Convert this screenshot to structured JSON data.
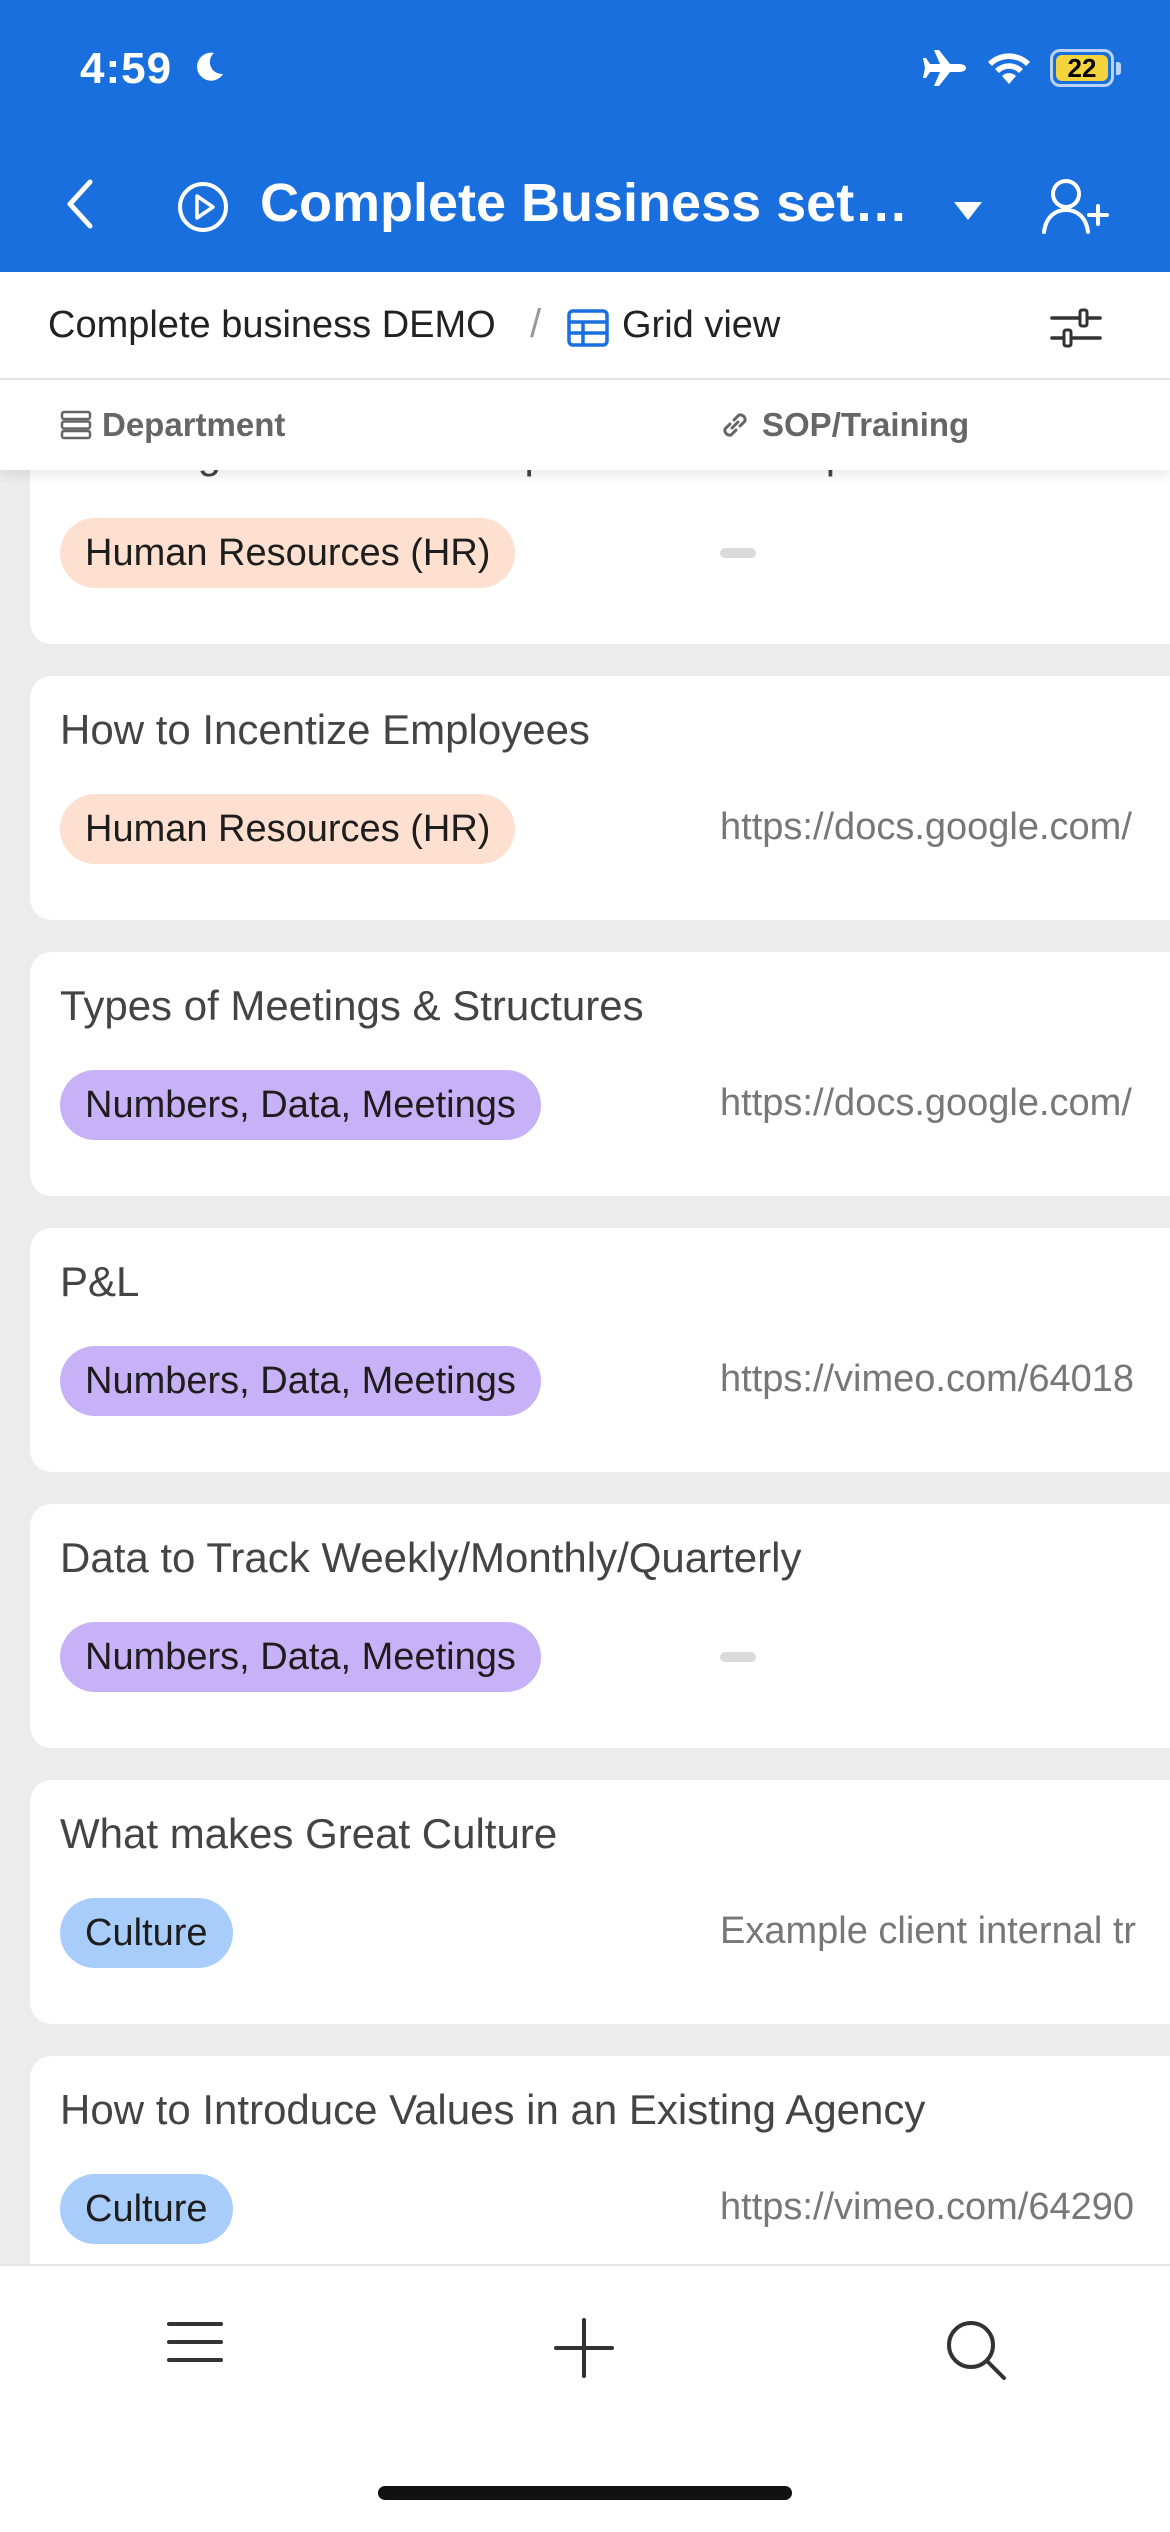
{
  "status_bar": {
    "time": "4:59",
    "battery": "22"
  },
  "header": {
    "title": "Complete Business setu..."
  },
  "breadcrumb": {
    "base": "Complete business DEMO",
    "separator": "/",
    "view": "Grid view"
  },
  "columns": {
    "department": "Department",
    "sop": "SOP/Training"
  },
  "records": [
    {
      "title": "Showing team members potential career paths",
      "tag": "Human Resources (HR)",
      "link": ""
    },
    {
      "title": "How to Incentize Employees",
      "tag": "Human Resources (HR)",
      "link": "https://docs.google.com/"
    },
    {
      "title": "Types of Meetings & Structures",
      "tag": "Numbers, Data, Meetings",
      "link": "https://docs.google.com/"
    },
    {
      "title": "P&L",
      "tag": "Numbers, Data, Meetings",
      "link": "https://vimeo.com/64018"
    },
    {
      "title": "Data to Track Weekly/Monthly/Quarterly",
      "tag": "Numbers, Data, Meetings",
      "link": ""
    },
    {
      "title": "What makes Great Culture",
      "tag": "Culture",
      "link": "Example client internal tr"
    },
    {
      "title": "How to Introduce Values in an Existing Agency",
      "tag": "Culture",
      "link": "https://vimeo.com/64290"
    }
  ],
  "colors": {
    "header_blue": "#1a6fde",
    "tag_hr": "#fde0cf",
    "tag_numbers": "#c7b2f8",
    "tag_culture": "#a9cdfa"
  },
  "icons": {
    "status": [
      "moon-icon",
      "airplane-icon",
      "wifi-icon",
      "battery-icon"
    ],
    "header": [
      "back-icon",
      "play-circle-icon",
      "caret-down-icon",
      "add-user-icon"
    ],
    "toolbar": [
      "grid-view-icon",
      "filter-icon"
    ],
    "columns": [
      "list-field-icon",
      "link-icon"
    ],
    "bottom": [
      "menu-icon",
      "plus-icon",
      "search-icon"
    ]
  }
}
